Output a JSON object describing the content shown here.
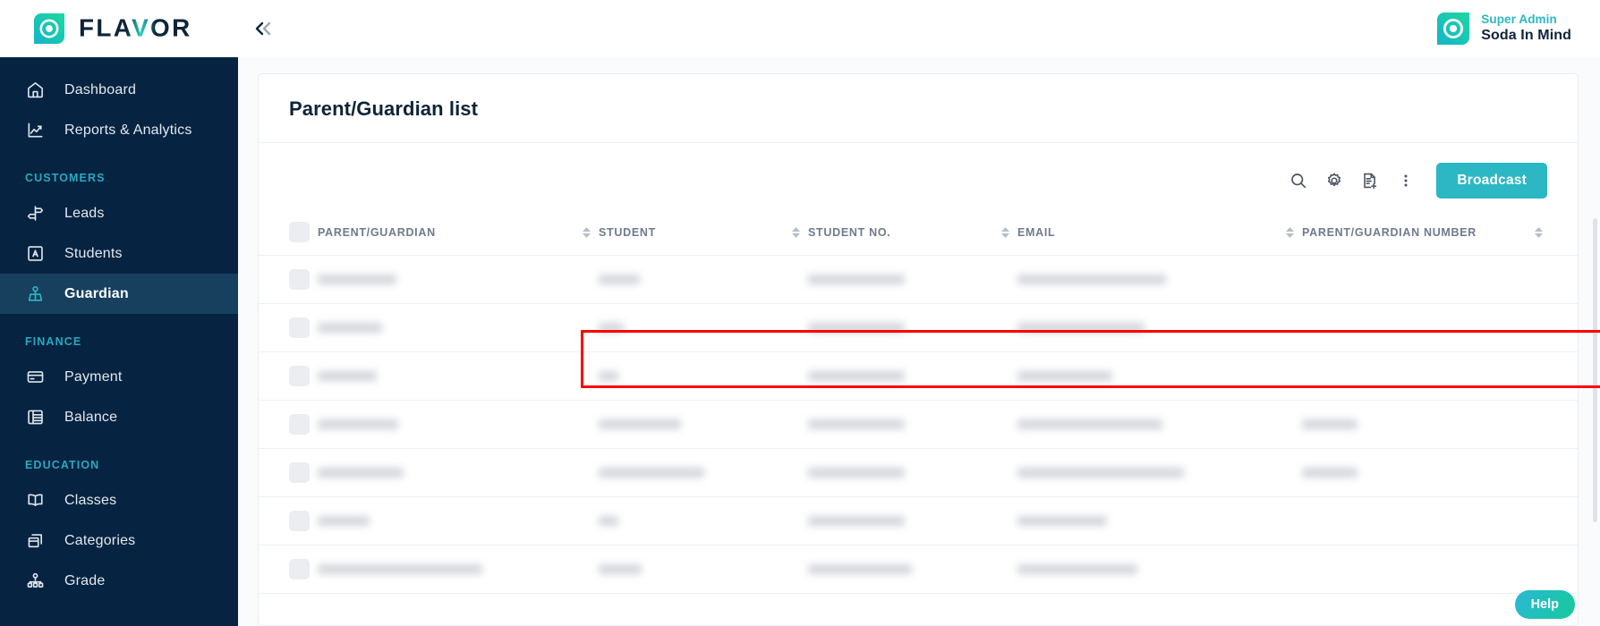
{
  "brand": {
    "name": "FLAVOR",
    "collapse_icon": "chevrons-left-icon"
  },
  "user": {
    "role": "Super Admin",
    "name": "Soda In Mind",
    "avatar_icon": "user-avatar-icon"
  },
  "sidebar": {
    "items": [
      {
        "label": "Dashboard",
        "icon": "home-icon",
        "type": "item",
        "active": false
      },
      {
        "label": "Reports & Analytics",
        "icon": "analytics-icon",
        "type": "item",
        "active": false
      },
      {
        "label": "CUSTOMERS",
        "type": "section"
      },
      {
        "label": "Leads",
        "icon": "signpost-icon",
        "type": "item",
        "active": false
      },
      {
        "label": "Students",
        "icon": "id-card-icon",
        "type": "item",
        "active": false
      },
      {
        "label": "Guardian",
        "icon": "guardian-icon",
        "type": "item",
        "active": true
      },
      {
        "label": "FINANCE",
        "type": "section"
      },
      {
        "label": "Payment",
        "icon": "credit-card-icon",
        "type": "item",
        "active": false
      },
      {
        "label": "Balance",
        "icon": "ledger-icon",
        "type": "item",
        "active": false
      },
      {
        "label": "EDUCATION",
        "type": "section"
      },
      {
        "label": "Classes",
        "icon": "book-open-icon",
        "type": "item",
        "active": false
      },
      {
        "label": "Categories",
        "icon": "layers-icon",
        "type": "item",
        "active": false
      },
      {
        "label": "Grade",
        "icon": "hierarchy-icon",
        "type": "item",
        "active": false
      }
    ]
  },
  "page": {
    "title": "Parent/Guardian list"
  },
  "toolbar": {
    "icons": [
      {
        "name": "search-icon"
      },
      {
        "name": "gear-icon"
      },
      {
        "name": "export-document-icon"
      },
      {
        "name": "more-vertical-icon"
      }
    ],
    "broadcast_label": "Broadcast"
  },
  "table": {
    "columns": [
      "PARENT/GUARDIAN",
      "STUDENT",
      "STUDENT NO.",
      "EMAIL",
      "PARENT/GUARDIAN NUMBER"
    ],
    "page_dots": 2,
    "active_dot": 0,
    "rows": [
      {
        "redacted": true,
        "widths": [
          88,
          46,
          108,
          166,
          0
        ],
        "highlighted": true
      },
      {
        "redacted": true,
        "widths": [
          72,
          28,
          108,
          142,
          0
        ],
        "highlighted": false
      },
      {
        "redacted": true,
        "widths": [
          66,
          22,
          108,
          106,
          0
        ],
        "highlighted": false
      },
      {
        "redacted": true,
        "widths": [
          90,
          92,
          108,
          162,
          62
        ],
        "highlighted": false
      },
      {
        "redacted": true,
        "widths": [
          96,
          118,
          108,
          186,
          62
        ],
        "highlighted": false
      },
      {
        "redacted": true,
        "widths": [
          58,
          22,
          108,
          100,
          0
        ],
        "highlighted": false
      },
      {
        "redacted": true,
        "widths": [
          184,
          48,
          116,
          134,
          0
        ],
        "highlighted": false
      }
    ]
  },
  "help": {
    "label": "Help"
  },
  "colors": {
    "sidebar_bg": "#062441",
    "sidebar_active": "#16405e",
    "accent_teal": "#2bb8c4",
    "section_label": "#2aa9c0",
    "title_navy": "#0d2438",
    "annotation_red": "#fe0000",
    "page_bg": "#fafbfc"
  }
}
